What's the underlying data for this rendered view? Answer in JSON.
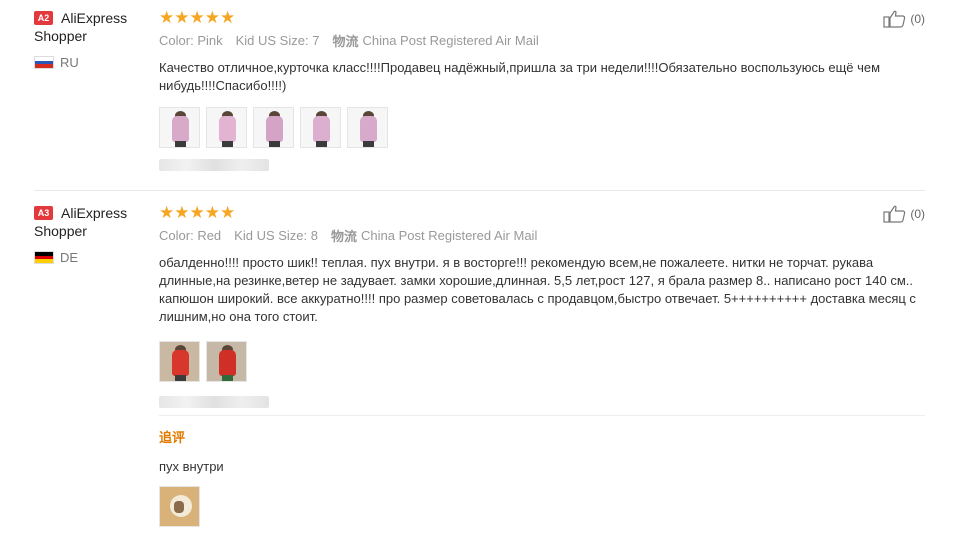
{
  "reviews": [
    {
      "badge": "A2",
      "user_name_line1": "AliExpress",
      "user_name_line2": "Shopper",
      "country": "RU",
      "rating_stars": 5,
      "meta": {
        "color_label": "Color:",
        "color_value": "Pink",
        "size_label": "Kid US Size:",
        "size_value": "7",
        "shipping_label": "物流",
        "shipping_value": "China Post Registered Air Mail"
      },
      "text": "Качество отличное,курточка класс!!!!Продавец надёжный,пришла за три недели!!!!Обязательно воспользуюсь ещё чем нибудь!!!!Спасибо!!!!)",
      "likes": "(0)",
      "photo_count": 5
    },
    {
      "badge": "A3",
      "user_name_line1": "AliExpress",
      "user_name_line2": "Shopper",
      "country": "DE",
      "rating_stars": 5,
      "meta": {
        "color_label": "Color:",
        "color_value": "Red",
        "size_label": "Kid US Size:",
        "size_value": "8",
        "shipping_label": "物流",
        "shipping_value": "China Post Registered Air Mail"
      },
      "text": "обалденно!!!! просто шик!! теплая. пух внутри. я в восторге!!! рекомендую всем,не пожалеете. нитки не торчат. рукава длинные,на резинке,ветер не задувает. замки хорошие,длинная. 5,5 лет,рост 127, я брала размер 8.. написано рост 140 см.. капюшон широкий. все аккуратно!!!! про размер советовалась с продавцом,быстро отвечает. 5++++++++++ доставка месяц с лишним,но она того стоит.",
      "likes": "(0)",
      "photo_count": 2,
      "additional": {
        "title": "追评",
        "text": "пух внутри"
      }
    }
  ],
  "colors": {
    "star": "#f5a623",
    "badge": "#e4393c",
    "additional_title": "#e07b00",
    "photo_pink": "#d9a9c9",
    "photo_red": "#d8372e"
  },
  "icons": {
    "like": "thumbs-up-icon",
    "star": "star-icon"
  }
}
